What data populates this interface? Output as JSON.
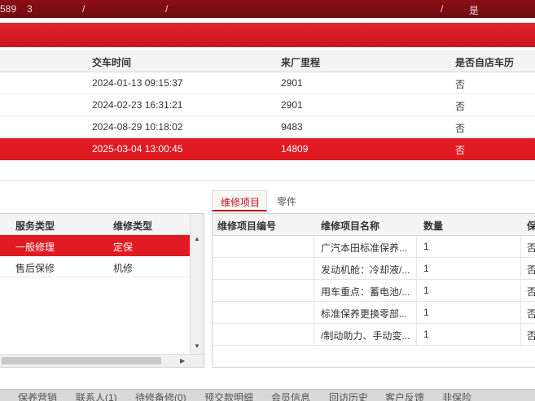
{
  "topbar": {
    "items": [
      "589",
      "3",
      "/",
      "/",
      "/",
      "是"
    ]
  },
  "top_grid": {
    "headers": [
      "交车时间",
      "来厂里程",
      "是否自店车历"
    ],
    "rows": [
      [
        "2024-01-13 09:15:37",
        "2901",
        "否"
      ],
      [
        "2024-02-23 16:31:21",
        "2901",
        "否"
      ],
      [
        "2024-08-29 10:18:02",
        "9483",
        "否"
      ],
      [
        "2025-03-04 13:00:45",
        "14809",
        "否"
      ]
    ],
    "selected_row": 3
  },
  "left_grid": {
    "headers": [
      "服务类型",
      "维修类型"
    ],
    "rows": [
      [
        "一般修理",
        "定保"
      ],
      [
        "售后保修",
        "机修"
      ]
    ],
    "selected_row": 0
  },
  "tabs": {
    "items": [
      "维修项目",
      "零件"
    ],
    "active": 0
  },
  "right_grid": {
    "headers": [
      "维修项目编号",
      "维修项目名称",
      "数量",
      "保"
    ],
    "rows": [
      [
        "",
        "广汽本田标准保养...",
        "1",
        "否"
      ],
      [
        "",
        "发动机舱：冷却液/...",
        "1",
        "否"
      ],
      [
        "",
        "用车重点：蓄电池/...",
        "1",
        "否"
      ],
      [
        "",
        "标准保养更换零部...",
        "1",
        "否"
      ],
      [
        "",
        "/制动助力、手动变...",
        "1",
        "否"
      ]
    ]
  },
  "bottom_tabs": [
    "",
    "保养营销",
    "联系人(1)",
    "待修备修(0)",
    "预交款明细",
    "会员信息",
    "回访历史",
    "客户反馈",
    "非保险"
  ],
  "colors": {
    "accent_red": "#e01a22",
    "topbar_red": "#7a0c12"
  }
}
